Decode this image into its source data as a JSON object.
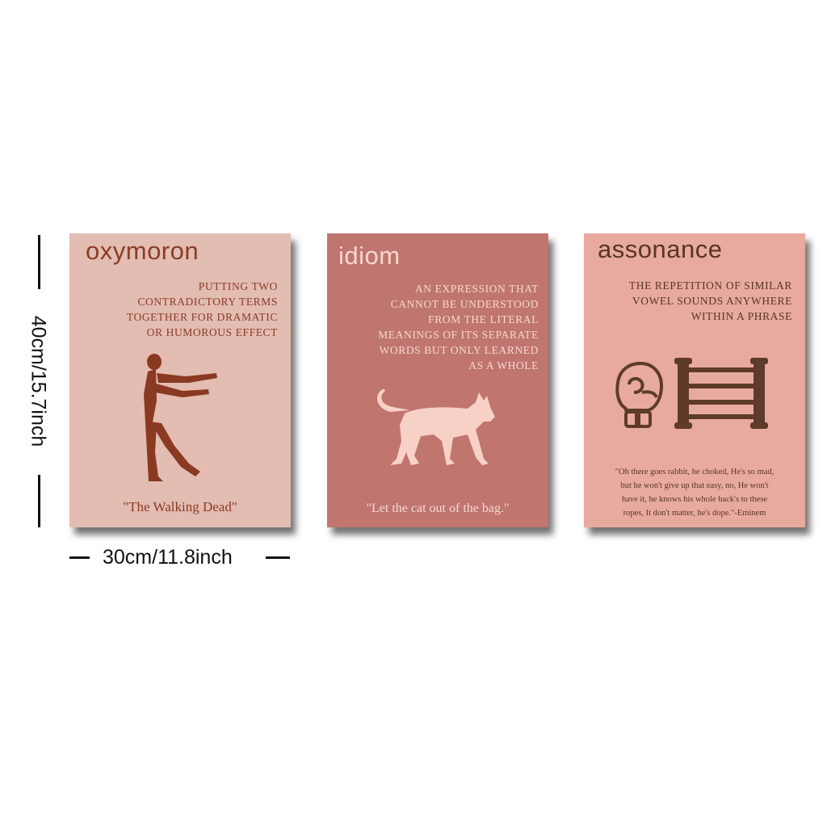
{
  "dimensions": {
    "height_label": "40cm/15.7inch",
    "width_label": "30cm/11.8inch"
  },
  "posters": [
    {
      "title": "oxymoron",
      "definition": [
        "PUTTING TWO",
        "CONTRADICTORY TERMS",
        "TOGETHER FOR DRAMATIC",
        "OR HUMOROUS EFFECT"
      ],
      "illustration": "zombie-silhouette",
      "quote": "\"The Walking Dead\"",
      "background": "#e3bcb2",
      "text_color": "#8a3c25"
    },
    {
      "title": "idiom",
      "definition": [
        "AN EXPRESSION THAT",
        "CANNOT BE UNDERSTOOD",
        "FROM THE LITERAL",
        "MEANINGS OF ITS SEPARATE",
        "WORDS BUT ONLY LEARNED",
        "AS A WHOLE"
      ],
      "illustration": "cat-silhouette",
      "quote": "\"Let the cat out of the bag.\"",
      "background": "#c0756f",
      "text_color": "#f6d8cf"
    },
    {
      "title": "assonance",
      "definition": [
        "THE REPETITION OF SIMILAR",
        "VOWEL SOUNDS ANYWHERE",
        "WITHIN A PHRASE"
      ],
      "illustration": "boxing-glove-and-ropes",
      "quote": [
        "\"Oh there goes rabbit, he choked, He's so mad,",
        "but he won't give up that easy, no, He won't",
        "have it, he knows his whole back's to these",
        "ropes, It don't matter, he's dope.\"-Eminem"
      ],
      "background": "#e8aa9e",
      "text_color": "#5a3424"
    }
  ]
}
